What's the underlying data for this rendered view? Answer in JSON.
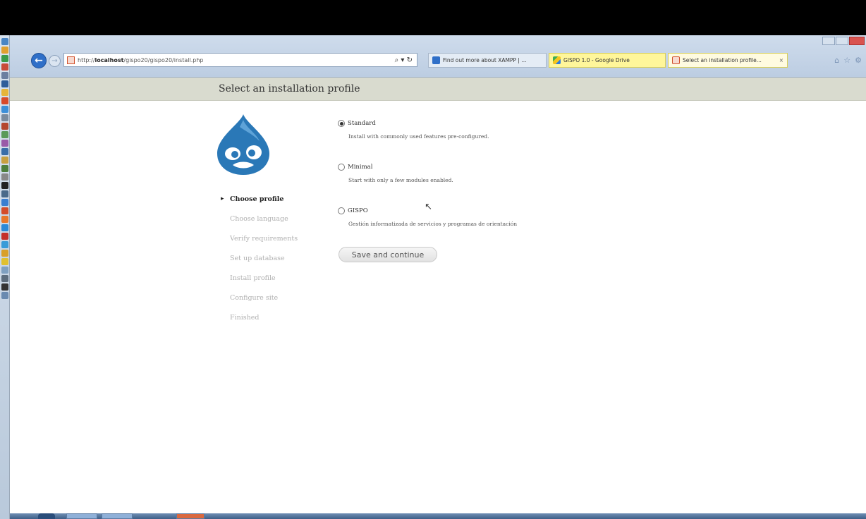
{
  "browser": {
    "url_prefix": "http://",
    "url_host": "localhost",
    "url_path": "/gispo20/gispo20/install.php",
    "address_tools": "⌕ ▾ ↻",
    "tabs": [
      {
        "label": "Find out more about XAMPP | ...",
        "close": ""
      },
      {
        "label": "GISPO 1.0 - Google Drive",
        "close": ""
      },
      {
        "label": "Select an installation profile...",
        "close": "×"
      }
    ]
  },
  "page": {
    "title": "Select an installation profile"
  },
  "tasks": [
    {
      "label": "Choose profile",
      "active": true
    },
    {
      "label": "Choose language",
      "active": false
    },
    {
      "label": "Verify requirements",
      "active": false
    },
    {
      "label": "Set up database",
      "active": false
    },
    {
      "label": "Install profile",
      "active": false
    },
    {
      "label": "Configure site",
      "active": false
    },
    {
      "label": "Finished",
      "active": false
    }
  ],
  "profiles": [
    {
      "label": "Standard",
      "description": "Install with commonly used features pre-configured.",
      "selected": true
    },
    {
      "label": "Minimal",
      "description": "Start with only a few modules enabled.",
      "selected": false
    },
    {
      "label": "GISPO",
      "description": "Gestión informatizada de servicios y programas de orientación",
      "selected": false
    }
  ],
  "actions": {
    "save_label": "Save and continue"
  },
  "colors": {
    "header_band": "#d9dbcf",
    "drupal_blue": "#2a78b7",
    "back_button": "#2f6fc8"
  }
}
